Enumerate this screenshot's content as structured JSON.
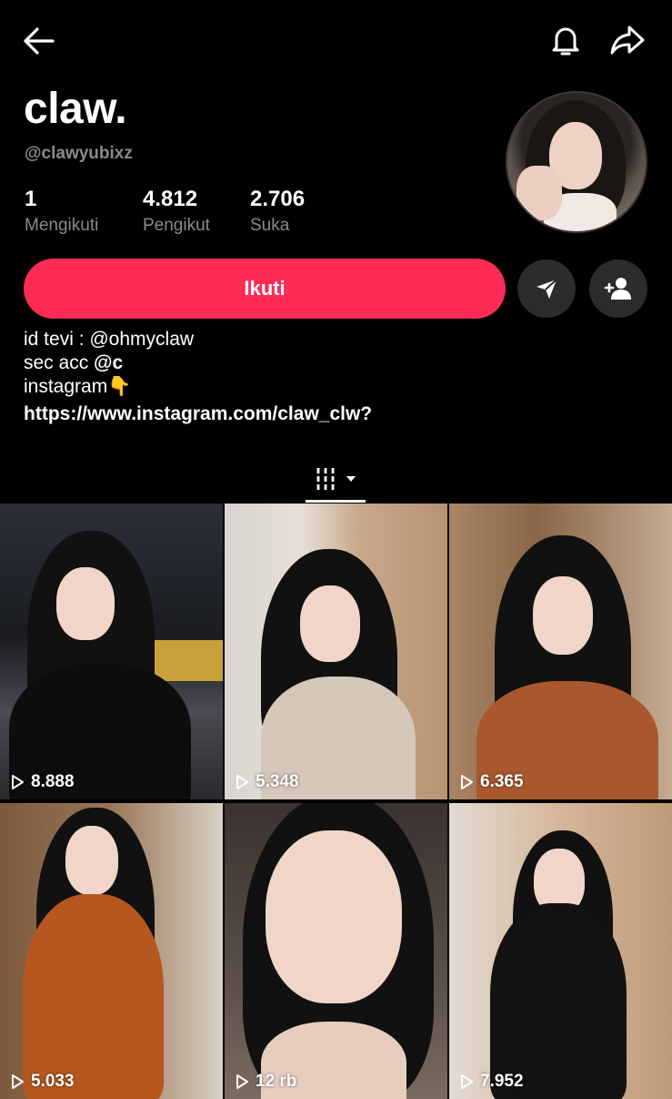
{
  "header": {
    "back_icon": "arrow-left-icon",
    "bell_icon": "bell-icon",
    "share_icon": "share-arrow-icon"
  },
  "profile": {
    "display_name": "claw.",
    "username": "@clawyubixz",
    "stats": [
      {
        "value": "1",
        "label": "Mengikuti"
      },
      {
        "value": "4.812",
        "label": "Pengikut"
      },
      {
        "value": "2.706",
        "label": "Suka"
      }
    ]
  },
  "actions": {
    "follow_label": "Ikuti",
    "message_icon": "send-message-icon",
    "add_friend_icon": "add-user-icon"
  },
  "bio": {
    "line1": "id tevi : @ohmyclaw",
    "line2_prefix": "sec acc ",
    "line2_bold": "@c",
    "line3": "instagram",
    "line3_emoji": "👇",
    "link": "https://www.instagram.com/claw_clw?"
  },
  "tabs": {
    "videos_icon": "grid-icon",
    "dropdown_icon": "caret-down-icon"
  },
  "videos": [
    {
      "views": "8.888"
    },
    {
      "views": "5.348"
    },
    {
      "views": "6.365"
    },
    {
      "views": "5.033"
    },
    {
      "views": "12 rb"
    },
    {
      "views": "7.952"
    }
  ],
  "colors": {
    "accent": "#fe2c55",
    "background": "#000000",
    "secondary_text": "#8a8a8a"
  }
}
